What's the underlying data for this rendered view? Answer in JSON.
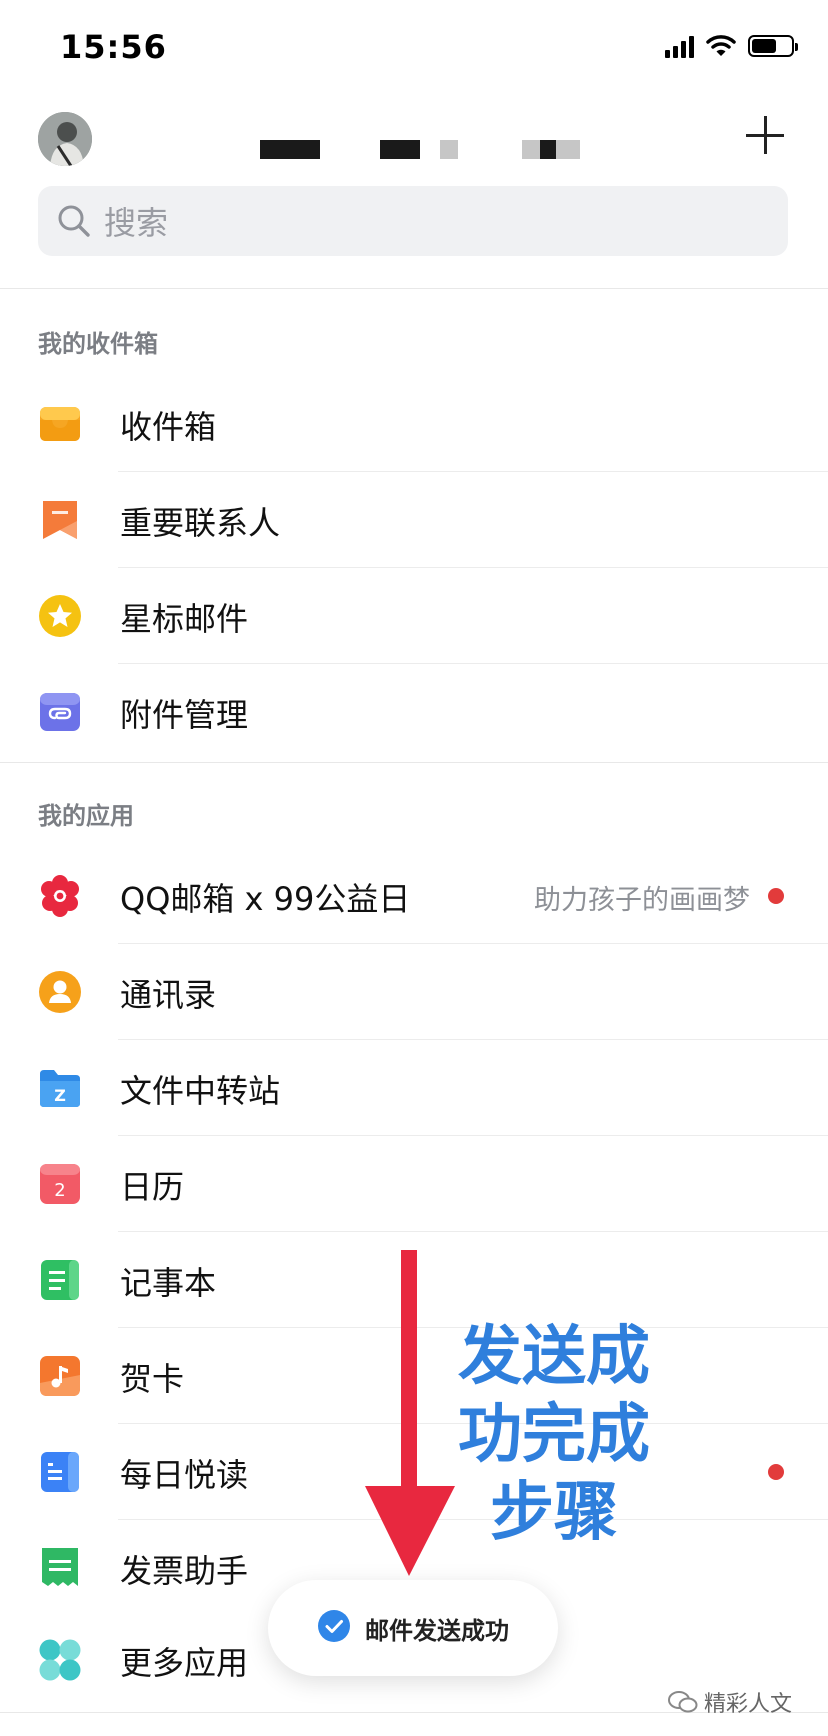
{
  "status_bar": {
    "time": "15:56"
  },
  "header": {
    "add_icon": "plus-icon"
  },
  "search": {
    "placeholder": "搜索",
    "icon": "search-icon"
  },
  "mailbox_section": {
    "title": "我的收件箱",
    "items": [
      {
        "label": "收件箱",
        "icon": "inbox-icon"
      },
      {
        "label": "重要联系人",
        "icon": "bookmark-icon"
      },
      {
        "label": "星标邮件",
        "icon": "star-icon"
      },
      {
        "label": "附件管理",
        "icon": "attachment-icon"
      }
    ]
  },
  "apps_section": {
    "title": "我的应用",
    "items": [
      {
        "label": "QQ邮箱 x 99公益日",
        "icon": "flower-icon",
        "note": "助力孩子的画画梦",
        "badge": "red-dot"
      },
      {
        "label": "通讯录",
        "icon": "contacts-icon"
      },
      {
        "label": "文件中转站",
        "icon": "folder-icon",
        "glyph": "Z"
      },
      {
        "label": "日历",
        "icon": "calendar-icon",
        "glyph": "2"
      },
      {
        "label": "记事本",
        "icon": "notepad-icon"
      },
      {
        "label": "贺卡",
        "icon": "music-card-icon"
      },
      {
        "label": "每日悦读",
        "icon": "reading-icon",
        "badge": "red-dot"
      },
      {
        "label": "发票助手",
        "icon": "invoice-icon"
      },
      {
        "label": "更多应用",
        "icon": "more-apps-icon"
      }
    ]
  },
  "annotation": {
    "lines": [
      "发送成",
      "功完成",
      "步骤"
    ],
    "color": "#2f7fdc",
    "arrow_color": "#e8283f"
  },
  "toast": {
    "text": "邮件发送成功",
    "icon": "check-circle-icon"
  },
  "watermark": {
    "text": "精彩人文"
  }
}
